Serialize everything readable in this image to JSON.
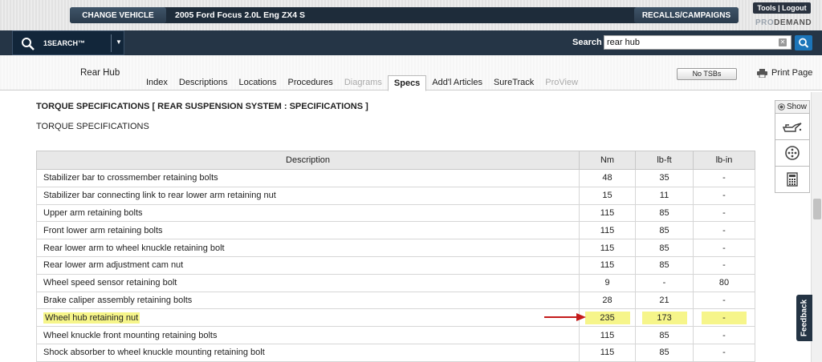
{
  "header": {
    "change_vehicle": "CHANGE VEHICLE",
    "vehicle": "2005 Ford Focus 2.0L Eng ZX4 S",
    "recalls": "RECALLS/CAMPAIGNS",
    "tools": "Tools | Logout",
    "brand_pro": "PRO",
    "brand_demand": "DEMAND"
  },
  "search": {
    "onesearch_label": "1SEARCH™",
    "label": "Search",
    "value": "rear hub"
  },
  "nav": {
    "section_title": "Rear Hub",
    "tabs": [
      {
        "label": "Index"
      },
      {
        "label": "Descriptions"
      },
      {
        "label": "Locations"
      },
      {
        "label": "Procedures"
      },
      {
        "label": "Diagrams"
      },
      {
        "label": "Specs"
      },
      {
        "label": "Add'l Articles"
      },
      {
        "label": "SureTrack"
      },
      {
        "label": "ProView"
      }
    ],
    "no_tsbs": "No TSBs",
    "print": "Print Page"
  },
  "content": {
    "title": "TORQUE SPECIFICATIONS [ REAR SUSPENSION SYSTEM : SPECIFICATIONS ]",
    "subtitle": "TORQUE SPECIFICATIONS",
    "columns": [
      "Description",
      "Nm",
      "lb-ft",
      "lb-in"
    ],
    "rows": [
      [
        "Stabilizer bar to crossmember retaining bolts",
        "48",
        "35",
        "-"
      ],
      [
        "Stabilizer bar connecting link to rear lower arm retaining nut",
        "15",
        "11",
        "-"
      ],
      [
        "Upper arm retaining bolts",
        "115",
        "85",
        "-"
      ],
      [
        "Front lower arm retaining bolts",
        "115",
        "85",
        "-"
      ],
      [
        "Rear lower arm to wheel knuckle retaining bolt",
        "115",
        "85",
        "-"
      ],
      [
        "Rear lower arm adjustment cam nut",
        "115",
        "85",
        "-"
      ],
      [
        "Wheel speed sensor retaining bolt",
        "9",
        "-",
        "80"
      ],
      [
        "Brake caliper assembly retaining bolts",
        "28",
        "21",
        "-"
      ],
      [
        "Wheel hub retaining nut",
        "235",
        "173",
        "-"
      ],
      [
        "Wheel knuckle front mounting retaining bolts",
        "115",
        "85",
        "-"
      ],
      [
        "Shock absorber to wheel knuckle mounting retaining bolt",
        "115",
        "85",
        "-"
      ]
    ],
    "highlighted_row": 8
  },
  "tools": {
    "show": "Show",
    "icons": [
      "oil-can-icon",
      "wheel-icon",
      "calculator-icon"
    ]
  },
  "feedback": "Feedback"
}
